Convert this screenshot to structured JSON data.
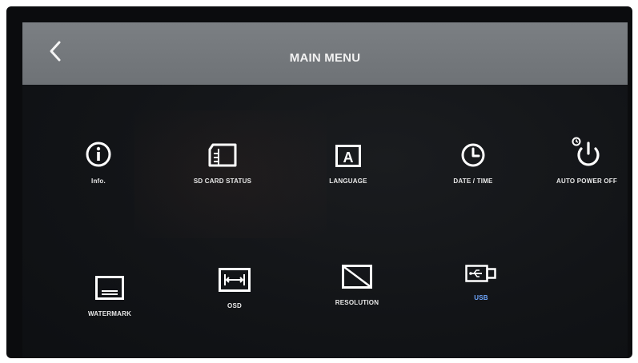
{
  "header": {
    "title": "MAIN MENU",
    "back_icon": "chevron-left-icon"
  },
  "menu": {
    "items": [
      {
        "label": "Info.",
        "icon": "info-icon"
      },
      {
        "label": "SD CARD STATUS",
        "icon": "sd-card-icon"
      },
      {
        "label": "LANGUAGE",
        "icon": "language-icon"
      },
      {
        "label": "DATE / TIME",
        "icon": "clock-icon"
      },
      {
        "label": "AUTO POWER OFF",
        "icon": "power-timer-icon"
      },
      {
        "label": "WATERMARK",
        "icon": "watermark-icon"
      },
      {
        "label": "OSD",
        "icon": "osd-icon"
      },
      {
        "label": "RESOLUTION",
        "icon": "resolution-icon"
      },
      {
        "label": "USB",
        "icon": "usb-icon"
      }
    ]
  },
  "colors": {
    "header_bg": "#74787c",
    "screen_bg": "#121417",
    "label": "#e9e9e9",
    "label_highlight": "#6fa7ff"
  }
}
